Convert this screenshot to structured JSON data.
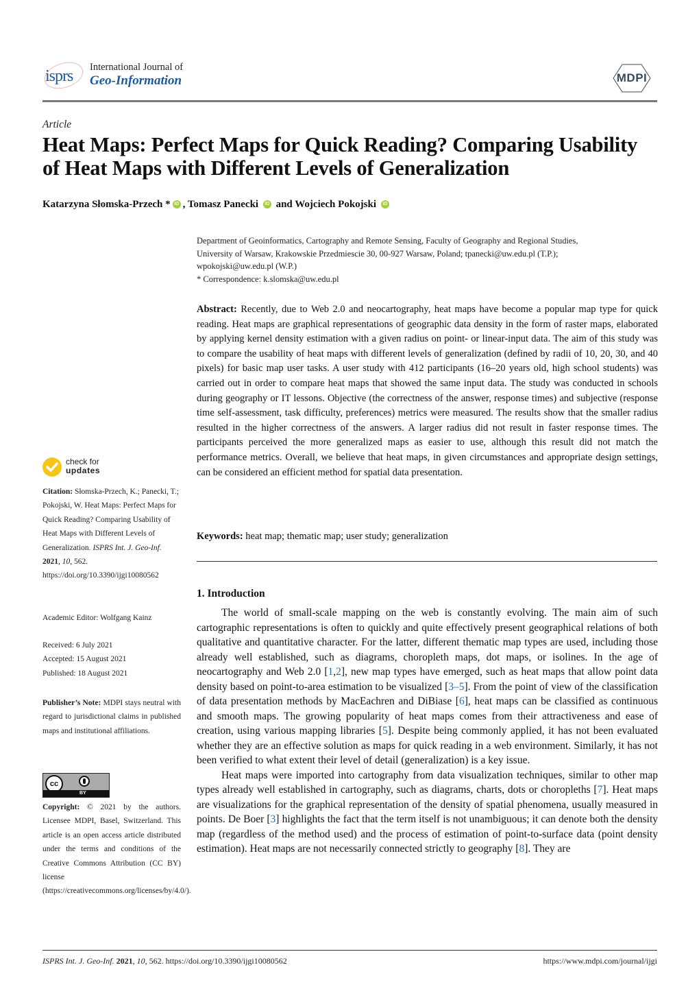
{
  "header": {
    "logo_text": "isprs",
    "journal_line1": "International Journal of",
    "journal_line2": "Geo-Information",
    "publisher_logo": "MDPI"
  },
  "article_type": "Article",
  "title": "Heat Maps: Perfect Maps for Quick Reading? Comparing Usability of Heat Maps with Different Levels of Generalization",
  "authors": [
    {
      "name": "Katarzyna Słomska-Przech",
      "mark": "*",
      "suffix": ", "
    },
    {
      "name": "Tomasz Panecki",
      "mark": "",
      "suffix": " and "
    },
    {
      "name": "Wojciech Pokojski",
      "mark": "",
      "suffix": ""
    }
  ],
  "orcid_label": "iD",
  "affiliation": {
    "line1": "Department of Geoinformatics, Cartography and Remote Sensing, Faculty of Geography and Regional Studies,",
    "line2": "University of Warsaw, Krakowskie Przedmiescie 30, 00-927 Warsaw, Poland; tpanecki@uw.edu.pl (T.P.);",
    "line3": "wpokojski@uw.edu.pl (W.P.)",
    "correspondence": "*  Correspondence: k.slomska@uw.edu.pl"
  },
  "abstract": {
    "label": "Abstract:",
    "text": "Recently, due to Web 2.0 and neocartography, heat maps have become a popular map type for quick reading. Heat maps are graphical representations of geographic data density in the form of raster maps, elaborated by applying kernel density estimation with a given radius on point- or linear-input data. The aim of this study was to compare the usability of heat maps with different levels of generalization (defined by radii of 10, 20, 30, and 40 pixels) for basic map user tasks. A user study with 412 participants (16–20 years old, high school students) was carried out in order to compare heat maps that showed the same input data. The study was conducted in schools during geography or IT lessons. Objective (the correctness of the answer, response times) and subjective (response time self-assessment, task difficulty, preferences) metrics were measured. The results show that the smaller radius resulted in the higher correctness of the answers. A larger radius did not result in faster response times. The participants perceived the more generalized maps as easier to use, although this result did not match the performance metrics. Overall, we believe that heat maps, in given circumstances and appropriate design settings, can be considered an efficient method for spatial data presentation."
  },
  "keywords": {
    "label": "Keywords:",
    "text": "heat map; thematic map; user study; generalization"
  },
  "sidebar": {
    "check_updates_line1": "check for",
    "check_updates_line2": "updates",
    "citation_label": "Citation:",
    "citation_text": "Słomska-Przech, K.; Panecki, T.; Pokojski, W. Heat Maps: Perfect Maps for Quick Reading? Comparing Usability of Heat Maps with Different Levels of Generalization.",
    "citation_journal": "ISPRS Int. J. Geo-Inf.",
    "citation_year": "2021",
    "citation_volume": "10",
    "citation_rest": ", 562.  https://doi.org/10.3390/ijgi10080562",
    "academic_editor": "Academic Editor: Wolfgang Kainz",
    "received": "Received: 6 July 2021",
    "accepted": "Accepted: 15 August 2021",
    "published": "Published: 18 August 2021",
    "publisher_note_label": "Publisher’s Note:",
    "publisher_note_text": "MDPI stays neutral with regard to jurisdictional claims in published maps and institutional affiliations.",
    "cc_label": "cc",
    "by_label": "BY",
    "copyright_label": "Copyright:",
    "copyright_text": "© 2021 by the authors. Licensee MDPI, Basel, Switzerland. This article is an open access article distributed under the terms and conditions of the Creative Commons Attribution (CC BY) license (https://creativecommons.org/licenses/by/4.0/)."
  },
  "intro": {
    "heading": "1. Introduction",
    "p1": [
      {
        "t": "The world of small-scale mapping on the web is constantly evolving.  The main aim of such cartographic representations is often to quickly and quite effectively present geographical relations of both qualitative and quantitative character. For the latter, different thematic map types are used, including those already well established, such as diagrams, choropleth maps, dot maps, or isolines. In the age of neocartography and Web 2.0 ["
      },
      {
        "ref": "1"
      },
      {
        "t": ","
      },
      {
        "ref": "2"
      },
      {
        "t": "], new map types have emerged, such as heat maps that allow point data density based on point-to-area estimation to be visualized ["
      },
      {
        "ref": "3–5"
      },
      {
        "t": "]. From the point of view of the classification of data presentation methods by MacEachren and DiBiase ["
      },
      {
        "ref": "6"
      },
      {
        "t": "], heat maps can be classified as continuous and smooth maps. The growing popularity of heat maps comes from their attractiveness and ease of creation, using various mapping libraries ["
      },
      {
        "ref": "5"
      },
      {
        "t": "].  Despite being commonly applied, it has not been evaluated whether they are an effective solution as maps for quick reading in a web environment. Similarly, it has not been verified to what extent their level of detail (generalization) is a key issue."
      }
    ],
    "p2": [
      {
        "t": "Heat maps were imported into cartography from data visualization techniques, similar to other map types already well established in cartography, such as diagrams, charts, dots or choropleths ["
      },
      {
        "ref": "7"
      },
      {
        "t": "]. Heat maps are visualizations for the graphical representation of the density of spatial phenomena, usually measured in points.  De Boer ["
      },
      {
        "ref": "3"
      },
      {
        "t": "] highlights the fact that the term itself is not unambiguous; it can denote both the density map (regardless of the method used) and the process of estimation of point-to-surface data (point density estimation). Heat maps are not necessarily connected strictly to geography ["
      },
      {
        "ref": "8"
      },
      {
        "t": "]. They are"
      }
    ]
  },
  "footer": {
    "journal": "ISPRS Int. J. Geo-Inf.",
    "year": "2021",
    "volume": "10",
    "rest": ", 562. https://doi.org/10.3390/ijgi10080562",
    "url": "https://www.mdpi.com/journal/ijgi"
  }
}
